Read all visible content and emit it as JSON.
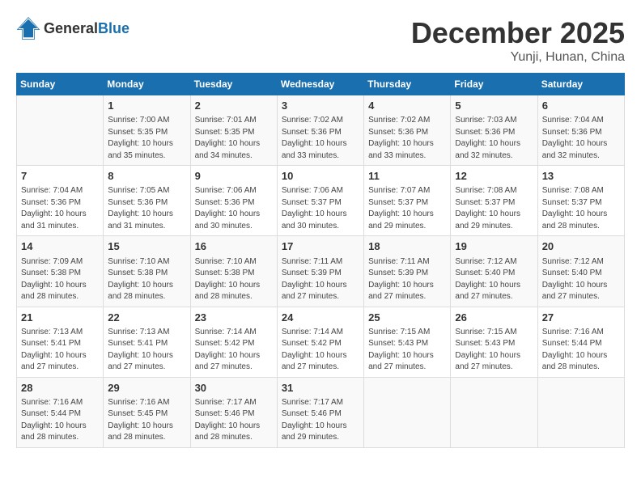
{
  "logo": {
    "general": "General",
    "blue": "Blue"
  },
  "title": "December 2025",
  "subtitle": "Yunji, Hunan, China",
  "days_header": [
    "Sunday",
    "Monday",
    "Tuesday",
    "Wednesday",
    "Thursday",
    "Friday",
    "Saturday"
  ],
  "weeks": [
    [
      {
        "day": "",
        "info": ""
      },
      {
        "day": "1",
        "info": "Sunrise: 7:00 AM\nSunset: 5:35 PM\nDaylight: 10 hours\nand 35 minutes."
      },
      {
        "day": "2",
        "info": "Sunrise: 7:01 AM\nSunset: 5:35 PM\nDaylight: 10 hours\nand 34 minutes."
      },
      {
        "day": "3",
        "info": "Sunrise: 7:02 AM\nSunset: 5:36 PM\nDaylight: 10 hours\nand 33 minutes."
      },
      {
        "day": "4",
        "info": "Sunrise: 7:02 AM\nSunset: 5:36 PM\nDaylight: 10 hours\nand 33 minutes."
      },
      {
        "day": "5",
        "info": "Sunrise: 7:03 AM\nSunset: 5:36 PM\nDaylight: 10 hours\nand 32 minutes."
      },
      {
        "day": "6",
        "info": "Sunrise: 7:04 AM\nSunset: 5:36 PM\nDaylight: 10 hours\nand 32 minutes."
      }
    ],
    [
      {
        "day": "7",
        "info": "Sunrise: 7:04 AM\nSunset: 5:36 PM\nDaylight: 10 hours\nand 31 minutes."
      },
      {
        "day": "8",
        "info": "Sunrise: 7:05 AM\nSunset: 5:36 PM\nDaylight: 10 hours\nand 31 minutes."
      },
      {
        "day": "9",
        "info": "Sunrise: 7:06 AM\nSunset: 5:36 PM\nDaylight: 10 hours\nand 30 minutes."
      },
      {
        "day": "10",
        "info": "Sunrise: 7:06 AM\nSunset: 5:37 PM\nDaylight: 10 hours\nand 30 minutes."
      },
      {
        "day": "11",
        "info": "Sunrise: 7:07 AM\nSunset: 5:37 PM\nDaylight: 10 hours\nand 29 minutes."
      },
      {
        "day": "12",
        "info": "Sunrise: 7:08 AM\nSunset: 5:37 PM\nDaylight: 10 hours\nand 29 minutes."
      },
      {
        "day": "13",
        "info": "Sunrise: 7:08 AM\nSunset: 5:37 PM\nDaylight: 10 hours\nand 28 minutes."
      }
    ],
    [
      {
        "day": "14",
        "info": "Sunrise: 7:09 AM\nSunset: 5:38 PM\nDaylight: 10 hours\nand 28 minutes."
      },
      {
        "day": "15",
        "info": "Sunrise: 7:10 AM\nSunset: 5:38 PM\nDaylight: 10 hours\nand 28 minutes."
      },
      {
        "day": "16",
        "info": "Sunrise: 7:10 AM\nSunset: 5:38 PM\nDaylight: 10 hours\nand 28 minutes."
      },
      {
        "day": "17",
        "info": "Sunrise: 7:11 AM\nSunset: 5:39 PM\nDaylight: 10 hours\nand 27 minutes."
      },
      {
        "day": "18",
        "info": "Sunrise: 7:11 AM\nSunset: 5:39 PM\nDaylight: 10 hours\nand 27 minutes."
      },
      {
        "day": "19",
        "info": "Sunrise: 7:12 AM\nSunset: 5:40 PM\nDaylight: 10 hours\nand 27 minutes."
      },
      {
        "day": "20",
        "info": "Sunrise: 7:12 AM\nSunset: 5:40 PM\nDaylight: 10 hours\nand 27 minutes."
      }
    ],
    [
      {
        "day": "21",
        "info": "Sunrise: 7:13 AM\nSunset: 5:41 PM\nDaylight: 10 hours\nand 27 minutes."
      },
      {
        "day": "22",
        "info": "Sunrise: 7:13 AM\nSunset: 5:41 PM\nDaylight: 10 hours\nand 27 minutes."
      },
      {
        "day": "23",
        "info": "Sunrise: 7:14 AM\nSunset: 5:42 PM\nDaylight: 10 hours\nand 27 minutes."
      },
      {
        "day": "24",
        "info": "Sunrise: 7:14 AM\nSunset: 5:42 PM\nDaylight: 10 hours\nand 27 minutes."
      },
      {
        "day": "25",
        "info": "Sunrise: 7:15 AM\nSunset: 5:43 PM\nDaylight: 10 hours\nand 27 minutes."
      },
      {
        "day": "26",
        "info": "Sunrise: 7:15 AM\nSunset: 5:43 PM\nDaylight: 10 hours\nand 27 minutes."
      },
      {
        "day": "27",
        "info": "Sunrise: 7:16 AM\nSunset: 5:44 PM\nDaylight: 10 hours\nand 28 minutes."
      }
    ],
    [
      {
        "day": "28",
        "info": "Sunrise: 7:16 AM\nSunset: 5:44 PM\nDaylight: 10 hours\nand 28 minutes."
      },
      {
        "day": "29",
        "info": "Sunrise: 7:16 AM\nSunset: 5:45 PM\nDaylight: 10 hours\nand 28 minutes."
      },
      {
        "day": "30",
        "info": "Sunrise: 7:17 AM\nSunset: 5:46 PM\nDaylight: 10 hours\nand 28 minutes."
      },
      {
        "day": "31",
        "info": "Sunrise: 7:17 AM\nSunset: 5:46 PM\nDaylight: 10 hours\nand 29 minutes."
      },
      {
        "day": "",
        "info": ""
      },
      {
        "day": "",
        "info": ""
      },
      {
        "day": "",
        "info": ""
      }
    ]
  ]
}
